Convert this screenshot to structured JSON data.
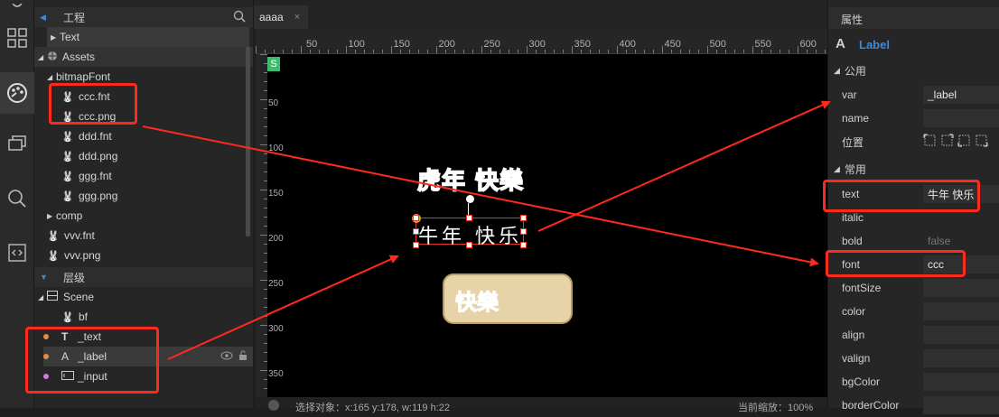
{
  "left_panel": {
    "project_title": "工程",
    "hierarchy_title": "层级",
    "assets": {
      "text_folder": "Text",
      "assets_folder": "Assets",
      "bitmapfont_folder": "bitmapFont",
      "files": [
        "ccc.fnt",
        "ccc.png",
        "ddd.fnt",
        "ddd.png",
        "ggg.fnt",
        "ggg.png"
      ],
      "comp_folder": "comp",
      "root_files": [
        "vvv.fnt",
        "vvv.png"
      ]
    },
    "scene": {
      "label": "Scene",
      "nodes": [
        {
          "label": "bf",
          "icon": "bunny-icon"
        },
        {
          "label": "_text",
          "icon": "text-type-icon",
          "dot": "#e8894a"
        },
        {
          "label": "_label",
          "icon": "label-type-icon",
          "dot": "#e8894a"
        },
        {
          "label": "_input",
          "icon": "input-type-icon",
          "dot": "#d07adf"
        }
      ]
    }
  },
  "editor": {
    "tab_label": "aaaa",
    "hruler_ticks": [
      "50",
      "100",
      "150",
      "200",
      "250",
      "300",
      "350",
      "400",
      "450",
      "500",
      "550",
      "600"
    ],
    "vruler_ticks": [
      "50",
      "100",
      "150",
      "200",
      "250",
      "300",
      "350"
    ],
    "stage_badge": "S",
    "bitmap_text_top": "虎年 快樂",
    "selected_label_text": "牛年 快乐",
    "button_text": "快樂",
    "status_text": "选择对象：x:165 y:178, w:119 h:22",
    "zoom_text": "当前缩放：100%"
  },
  "right_panel": {
    "tab_title": "属性",
    "component_name": "Label",
    "component_icon": "A",
    "group_common": "公用",
    "group_frequent": "常用",
    "props_common": [
      {
        "label": "var",
        "value": "_label"
      },
      {
        "label": "name",
        "value": ""
      },
      {
        "label": "位置",
        "value": ""
      }
    ],
    "props_frequent": [
      {
        "label": "text",
        "value": "牛年 快乐"
      },
      {
        "label": "italic",
        "value": ""
      },
      {
        "label": "bold",
        "value": "false"
      },
      {
        "label": "font",
        "value": "ccc"
      },
      {
        "label": "fontSize",
        "value": ""
      },
      {
        "label": "color",
        "value": ""
      },
      {
        "label": "align",
        "value": ""
      },
      {
        "label": "valign",
        "value": ""
      },
      {
        "label": "bgColor",
        "value": ""
      },
      {
        "label": "borderColor",
        "value": ""
      }
    ]
  },
  "colors": {
    "annotation_red": "#ff2a1d",
    "accent_blue": "#3d8ad8",
    "bitmap_orange": "#ff5a1a",
    "button_beige": "#e6d3a8"
  }
}
